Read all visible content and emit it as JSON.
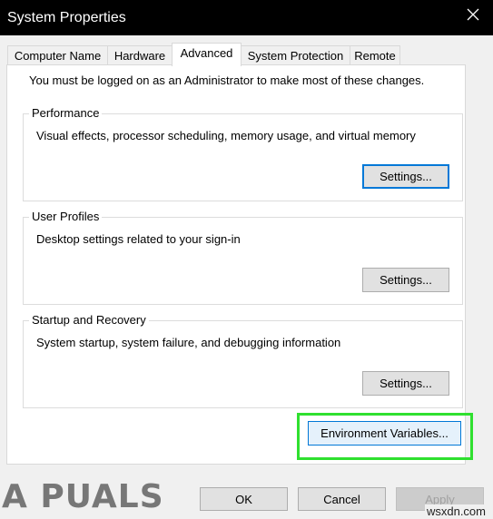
{
  "window": {
    "title": "System Properties"
  },
  "tabs": [
    {
      "label": "Computer Name",
      "active": false
    },
    {
      "label": "Hardware",
      "active": false
    },
    {
      "label": "Advanced",
      "active": true
    },
    {
      "label": "System Protection",
      "active": false
    },
    {
      "label": "Remote",
      "active": false
    }
  ],
  "advanced": {
    "admin_notice": "You must be logged on as an Administrator to make most of these changes.",
    "groups": [
      {
        "title": "Performance",
        "description": "Visual effects, processor scheduling, memory usage, and virtual memory",
        "button": "Settings..."
      },
      {
        "title": "User Profiles",
        "description": "Desktop settings related to your sign-in",
        "button": "Settings..."
      },
      {
        "title": "Startup and Recovery",
        "description": "System startup, system failure, and debugging information",
        "button": "Settings..."
      }
    ],
    "env_button": "Environment Variables..."
  },
  "footer": {
    "ok": "OK",
    "cancel": "Cancel",
    "apply": "Apply"
  },
  "overlay": {
    "logo_text": "A PUALS",
    "watermark": "wsxdn.com",
    "highlight_color": "#2fe02f"
  }
}
